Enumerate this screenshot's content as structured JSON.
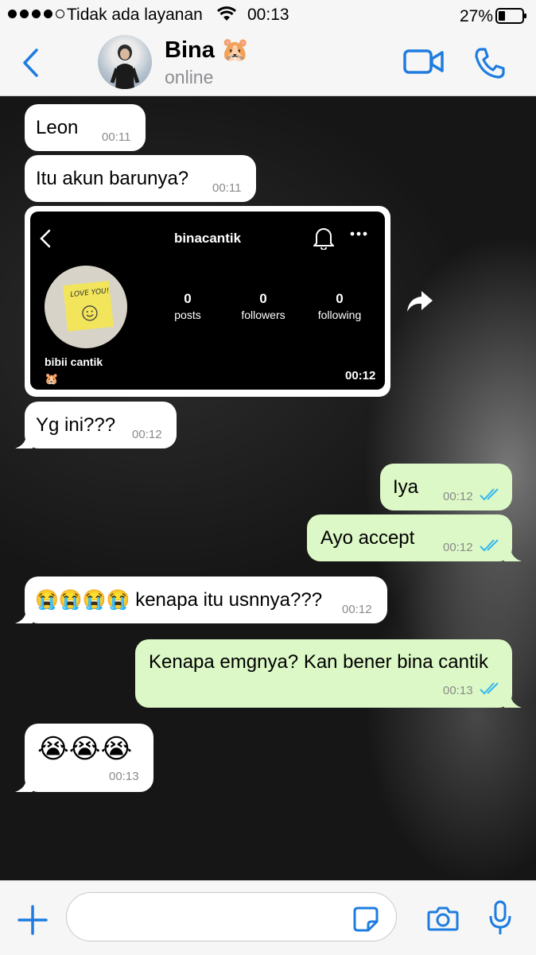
{
  "status_bar": {
    "carrier": "Tidak ada layanan",
    "time": "00:13",
    "battery": "27%"
  },
  "header": {
    "contact_name": "Bina 🐹",
    "contact_status": "online"
  },
  "colors": {
    "accent": "#1e7ce0",
    "incoming_bubble": "#ffffff",
    "outgoing_bubble": "#dcf8c6",
    "read_ticks": "#34b7f1"
  },
  "messages": [
    {
      "direction": "in",
      "text": "Leon",
      "time": "00:11"
    },
    {
      "direction": "in",
      "text": "Itu akun barunya?",
      "time": "00:11"
    },
    {
      "direction": "in",
      "type": "image",
      "time": "00:12",
      "image": {
        "username": "binacantik",
        "posts_count": "0",
        "posts_label": "posts",
        "followers_count": "0",
        "followers_label": "followers",
        "following_count": "0",
        "following_label": "following",
        "display_name": "bibii cantik",
        "bio_emoji": "🐹",
        "note_text": "LOVE YOU!!"
      }
    },
    {
      "direction": "in",
      "text": "Yg ini???",
      "time": "00:12"
    },
    {
      "direction": "out",
      "text": "Iya",
      "time": "00:12"
    },
    {
      "direction": "out",
      "text": "Ayo accept",
      "time": "00:12"
    },
    {
      "direction": "in",
      "text": "😭😭😭😭 kenapa itu usnnya???",
      "time": "00:12"
    },
    {
      "direction": "out",
      "text": "Kenapa emgnya? Kan bener bina cantik",
      "time": "00:13"
    },
    {
      "direction": "in",
      "text": "😭😭😭",
      "time": "00:13"
    }
  ],
  "input": {
    "placeholder": ""
  }
}
